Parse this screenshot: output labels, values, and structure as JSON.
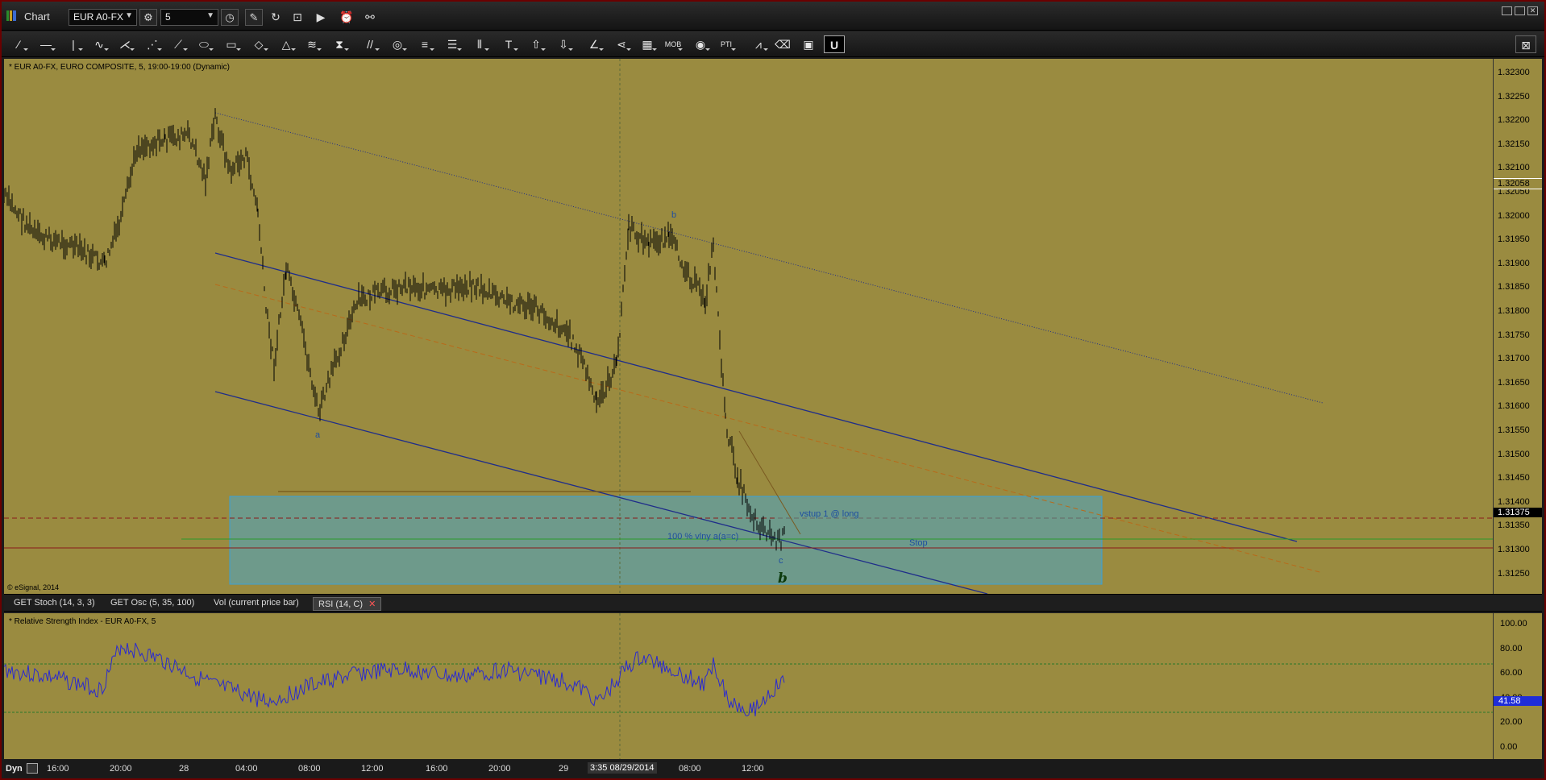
{
  "window": {
    "title": "Chart"
  },
  "toolbar_top": {
    "symbol": "EUR A0-FX",
    "interval": "5"
  },
  "chart": {
    "header": "* EUR A0-FX, EURO COMPOSITE, 5, 19:00-19:00 (Dynamic)",
    "copyright": "© eSignal, 2014",
    "labels": {
      "wave_a": "a",
      "wave_b_small": "b",
      "wave_c": "c",
      "wave_b_big": "b",
      "target": "100 % vlny a(a=c)",
      "vstup": "vstup 1 @ long",
      "stop": "Stop"
    },
    "price_ticks": [
      "1.32300",
      "1.32250",
      "1.32200",
      "1.32150",
      "1.32100",
      "1.32050",
      "1.32000",
      "1.31950",
      "1.31900",
      "1.31850",
      "1.31800",
      "1.31750",
      "1.31700",
      "1.31650",
      "1.31600",
      "1.31550",
      "1.31500",
      "1.31450",
      "1.31400",
      "1.31350",
      "1.31300",
      "1.31250"
    ],
    "price_marker_1": "1.32058",
    "price_marker_2": "1.31375",
    "colors": {
      "background": "#9a8b40",
      "channel": "#1f2d8a",
      "box": "#4aa8c8"
    }
  },
  "study_tabs": [
    {
      "label": "GET Stoch (14, 3, 3)"
    },
    {
      "label": "GET Osc (5, 35, 100)"
    },
    {
      "label": "Vol (current price bar)"
    },
    {
      "label": "RSI (14, C)"
    }
  ],
  "rsi": {
    "header": "* Relative Strength Index - EUR A0-FX, 5",
    "ticks": [
      "100.00",
      "80.00",
      "60.00",
      "40.00",
      "20.00",
      "0.00"
    ],
    "current_value": "41.58"
  },
  "x_axis": {
    "mode": "Dyn",
    "labels": [
      "16:00",
      "20:00",
      "28",
      "04:00",
      "08:00",
      "12:00",
      "16:00",
      "20:00",
      "29",
      "08:00",
      "12:00"
    ],
    "cursor": "3:35 08/29/2014"
  }
}
